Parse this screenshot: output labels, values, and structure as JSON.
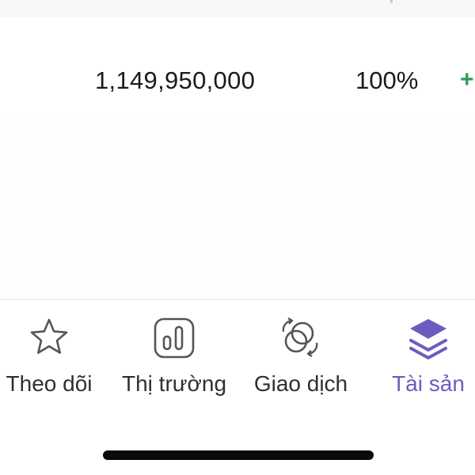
{
  "summary": {
    "value": "1,149,950,000",
    "percent": "100%",
    "action": "+"
  },
  "bottom_nav": {
    "items": [
      {
        "label": "Theo dõi",
        "icon": "star-icon",
        "active": false
      },
      {
        "label": "Thị trường",
        "icon": "chart-bars-icon",
        "active": false
      },
      {
        "label": "Giao dịch",
        "icon": "exchange-circles-icon",
        "active": false
      },
      {
        "label": "Tài sản",
        "icon": "layers-stack-icon",
        "active": true
      }
    ]
  },
  "colors": {
    "accent": "#6b5cc0",
    "positive": "#2f9b57",
    "text": "#1b1b1f"
  }
}
